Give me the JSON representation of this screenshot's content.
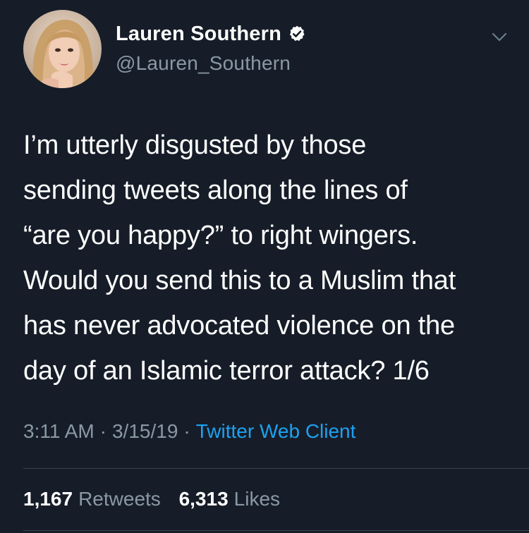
{
  "author": {
    "display_name": "Lauren Southern",
    "handle": "@Lauren_Southern",
    "verified_icon": "verified-badge-icon"
  },
  "tweet": {
    "lines": [
      "I’m utterly disgusted by those",
      "sending tweets along the lines of",
      "“are you happy?” to right wingers.",
      "Would you send this to a Muslim that",
      "has never advocated violence on the",
      "day of an Islamic terror attack? 1/6"
    ]
  },
  "meta": {
    "time": "3:11 AM",
    "separator": "·",
    "date": "3/15/19",
    "client": "Twitter Web Client"
  },
  "stats": {
    "retweets_count": "1,167",
    "retweets_label": "Retweets",
    "likes_count": "6,313",
    "likes_label": "Likes"
  },
  "colors": {
    "background": "#161d28",
    "secondary_text": "#8a98a6",
    "link": "#1da1f2",
    "divider": "#38444d"
  }
}
